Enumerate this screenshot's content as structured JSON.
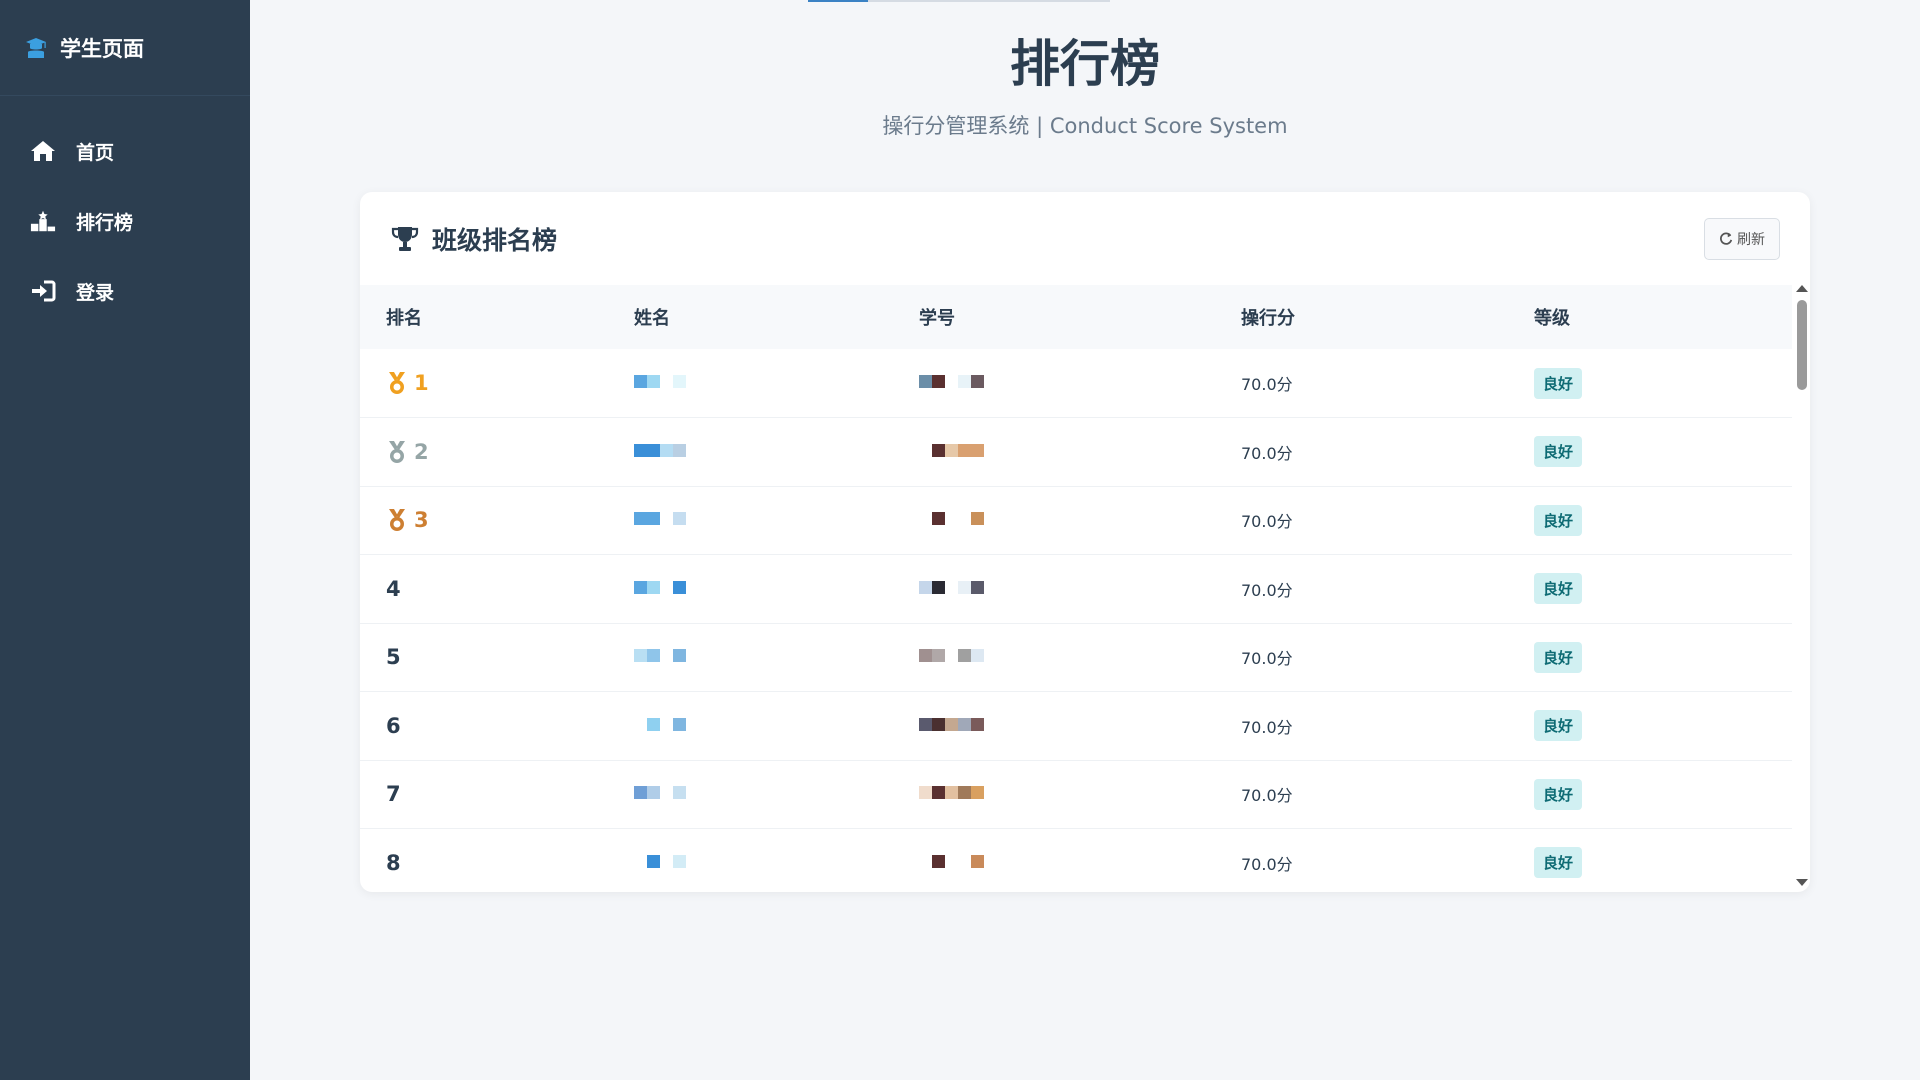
{
  "sidebar": {
    "brand": "学生页面",
    "items": [
      {
        "label": "首页",
        "icon": "home-icon"
      },
      {
        "label": "排行榜",
        "icon": "podium-icon"
      },
      {
        "label": "登录",
        "icon": "login-icon"
      }
    ]
  },
  "header": {
    "title": "排行榜",
    "subtitle": "操行分管理系统 | Conduct Score System"
  },
  "card": {
    "title": "班级排名榜",
    "refresh_label": "刷新",
    "columns": [
      "排名",
      "姓名",
      "学号",
      "操行分",
      "等级"
    ]
  },
  "rows": [
    {
      "rank": "1",
      "score": "70.0分",
      "level": "良好",
      "medal": "gold"
    },
    {
      "rank": "2",
      "score": "70.0分",
      "level": "良好",
      "medal": "silver"
    },
    {
      "rank": "3",
      "score": "70.0分",
      "level": "良好",
      "medal": "bronze"
    },
    {
      "rank": "4",
      "score": "70.0分",
      "level": "良好"
    },
    {
      "rank": "5",
      "score": "70.0分",
      "level": "良好"
    },
    {
      "rank": "6",
      "score": "70.0分",
      "level": "良好"
    },
    {
      "rank": "7",
      "score": "70.0分",
      "level": "良好"
    },
    {
      "rank": "8",
      "score": "70.0分",
      "level": "良好"
    }
  ],
  "colors": {
    "sidebar_bg": "#2c3e50",
    "gold": "#f0a020",
    "silver": "#95a5a6",
    "bronze": "#cd7f32",
    "badge_bg": "#d1f0f2",
    "badge_text": "#0e6b74"
  }
}
